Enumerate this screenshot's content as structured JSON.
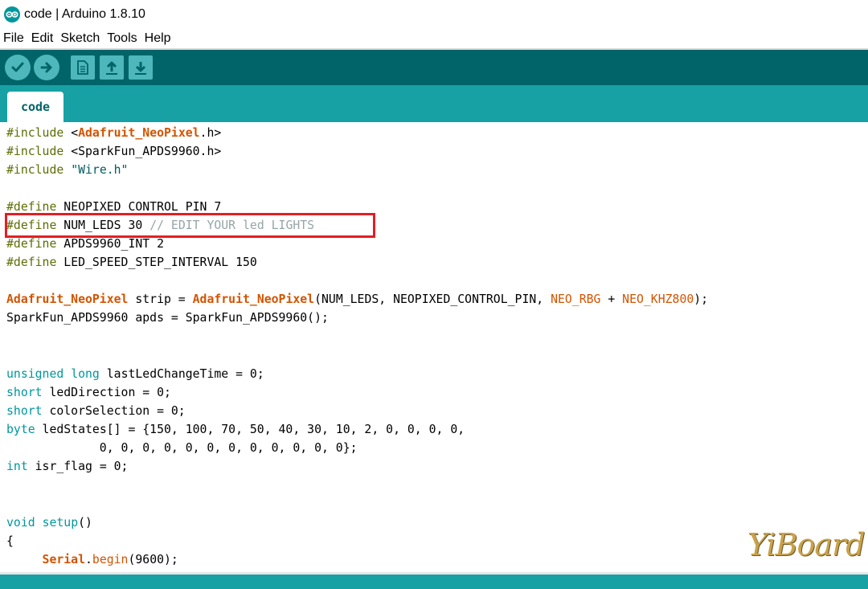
{
  "window": {
    "title": "code | Arduino 1.8.10"
  },
  "menu": [
    "File",
    "Edit",
    "Sketch",
    "Tools",
    "Help"
  ],
  "toolbar": {
    "buttons": [
      {
        "name": "verify-button",
        "icon": "check-icon"
      },
      {
        "name": "upload-button",
        "icon": "arrow-right-icon"
      },
      {
        "name": "new-button",
        "icon": "document-icon"
      },
      {
        "name": "open-button",
        "icon": "arrow-up-icon"
      },
      {
        "name": "save-button",
        "icon": "arrow-down-icon"
      }
    ]
  },
  "tabs": [
    {
      "label": "code"
    }
  ],
  "code": {
    "l1": [
      "#include ",
      "<",
      "Adafruit_NeoPixel",
      ".h>"
    ],
    "l2": [
      "#include ",
      "<SparkFun_APDS9960.h>"
    ],
    "l3": [
      "#include ",
      "\"Wire.h\""
    ],
    "l5": [
      "#define ",
      "NEOPIXED_CONTROL_PIN 7"
    ],
    "l6": [
      "#define ",
      "NUM_LEDS 30 ",
      "// EDIT YOUR led LIGHTS"
    ],
    "l7": [
      "#define ",
      "APDS9960_INT 2"
    ],
    "l8": [
      "#define ",
      "LED_SPEED_STEP_INTERVAL 150"
    ],
    "l10": [
      "Adafruit_NeoPixel",
      " strip = ",
      "Adafruit_NeoPixel",
      "(NUM_LEDS, NEOPIXED_CONTROL_PIN, ",
      "NEO_RBG",
      " + ",
      "NEO_KHZ800",
      ");"
    ],
    "l11": [
      "SparkFun_APDS9960 apds = SparkFun_APDS9960();"
    ],
    "l14": [
      "unsigned",
      " ",
      "long",
      " lastLedChangeTime = 0;"
    ],
    "l15": [
      "short",
      " ledDirection = 0;"
    ],
    "l16": [
      "short",
      " colorSelection = 0;"
    ],
    "l17": [
      "byte",
      " ledStates[] = {150, 100, 70, 50, 40, 30, 10, 2, 0, 0, 0, 0,"
    ],
    "l18": [
      "             0, 0, 0, 0, 0, 0, 0, 0, 0, 0, 0, 0};"
    ],
    "l19": [
      "int",
      " isr_flag = 0;"
    ],
    "l22": [
      "void",
      " ",
      "setup",
      "()"
    ],
    "l23": [
      "{"
    ],
    "l24": [
      "     ",
      "Serial",
      ".",
      "begin",
      "(9600);"
    ]
  },
  "watermark": {
    "text": "YiBoard"
  },
  "colors": {
    "toolbar": "#006468",
    "tabbar": "#17a1a5",
    "keyword": "#00979c",
    "library": "#d35400",
    "preprocessor": "#5e6d03",
    "comment": "#95a5a6",
    "highlight": "#e31e24"
  }
}
